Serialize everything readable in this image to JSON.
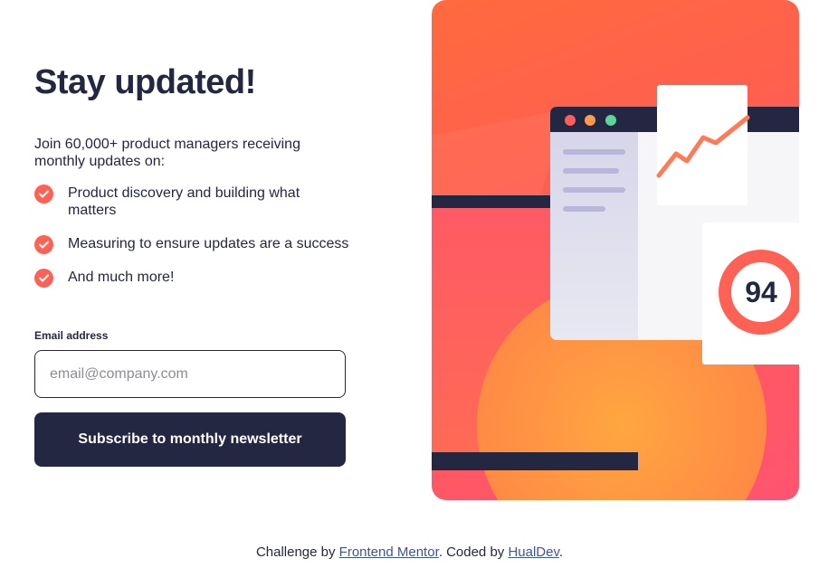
{
  "signup": {
    "title": "Stay updated!",
    "intro": "Join 60,000+ product managers receiving monthly updates on:",
    "features": [
      "Product discovery and building what matters",
      "Measuring to ensure updates are a success",
      "And much more!"
    ],
    "email_label": "Email address",
    "email_placeholder": "email@company.com",
    "email_value": "",
    "subscribe_label": "Subscribe to monthly newsletter"
  },
  "illustration": {
    "score": "94",
    "colors": {
      "tomato": "#ff6155",
      "navy": "#242742",
      "orange": "#ff9a45",
      "pink": "#ff5470",
      "dot_red": "#ff5c5c",
      "dot_orange": "#ff9a4f",
      "dot_green": "#5fd49a"
    }
  },
  "footer": {
    "prefix": "Challenge by ",
    "link1": "Frontend Mentor",
    "middle": ". Coded by ",
    "link2": "HualDev",
    "suffix": "."
  }
}
